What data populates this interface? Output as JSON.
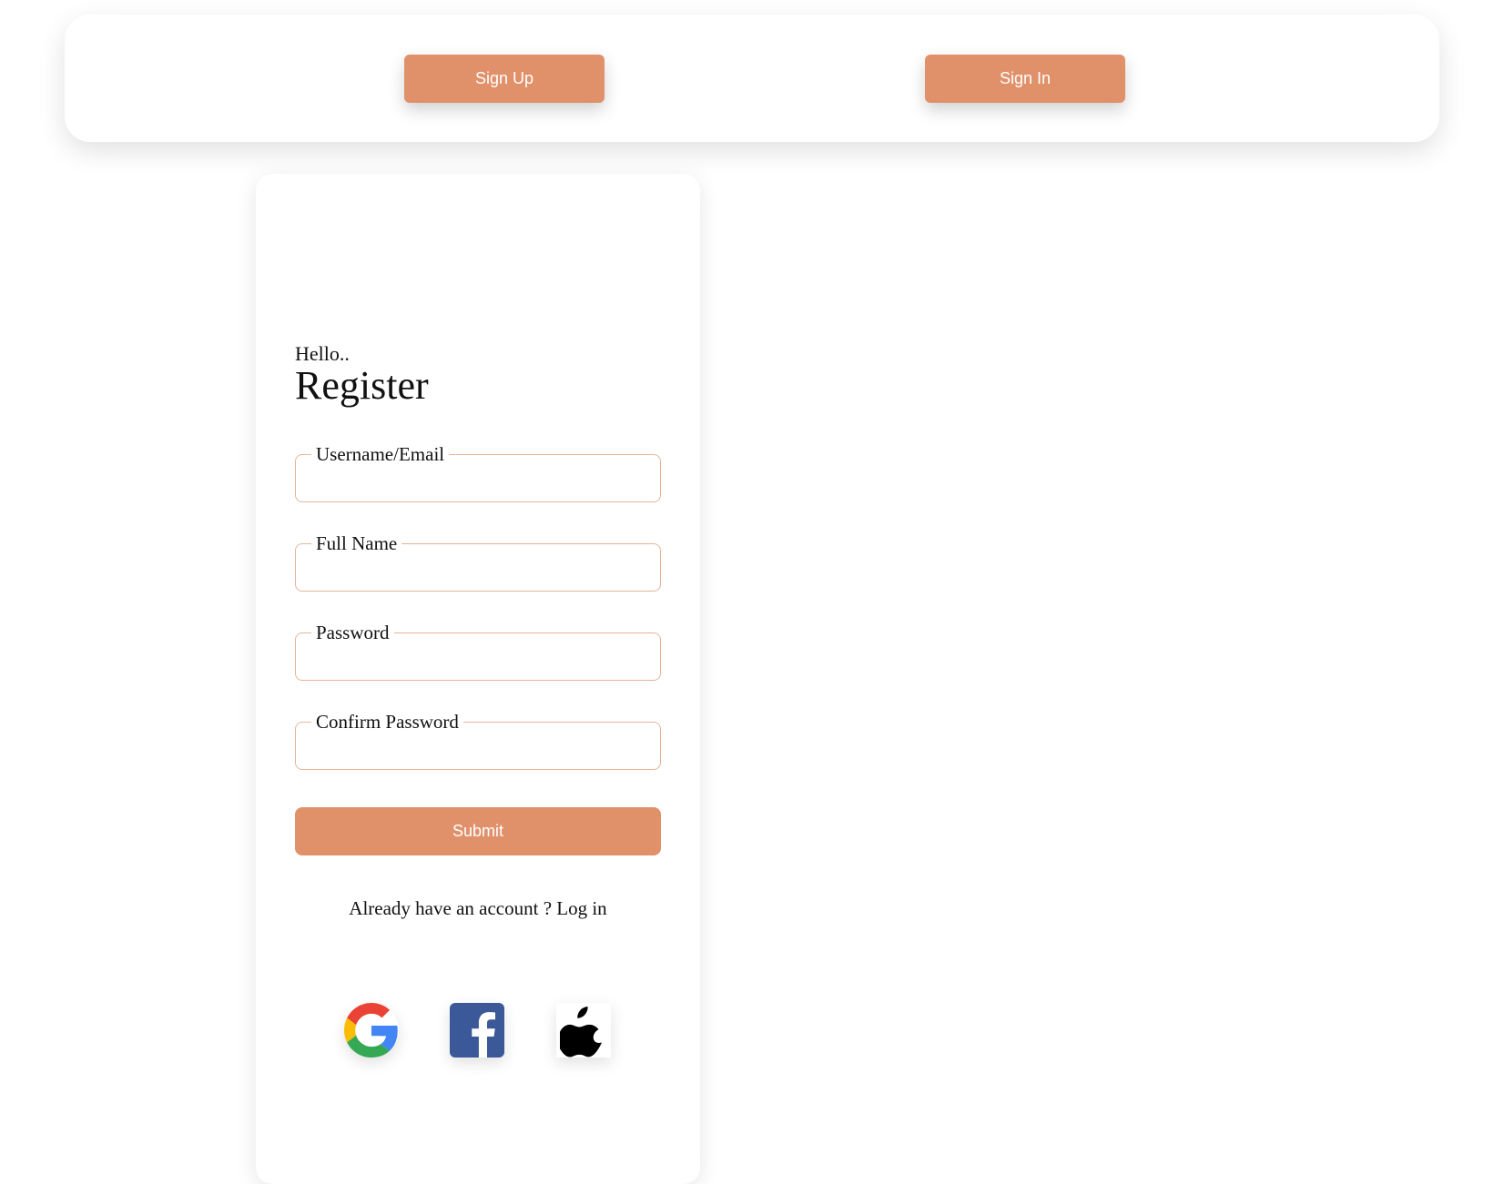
{
  "nav": {
    "signup_label": "Sign Up",
    "signin_label": "Sign In"
  },
  "form": {
    "greeting": "Hello..",
    "title": "Register",
    "fields": [
      {
        "label": "Username/Email",
        "value": ""
      },
      {
        "label": "Full Name",
        "value": ""
      },
      {
        "label": "Password",
        "value": ""
      },
      {
        "label": "Confirm Password",
        "value": ""
      }
    ],
    "submit_label": "Submit",
    "already_text": "Already have an account ?",
    "login_label": "Log in"
  },
  "social": [
    {
      "name": "google",
      "icon": "google-icon"
    },
    {
      "name": "facebook",
      "icon": "facebook-icon"
    },
    {
      "name": "apple",
      "icon": "apple-icon"
    }
  ],
  "colors": {
    "accent": "#e0916a",
    "field_border": "#e6b49a",
    "facebook_blue": "#3b5998"
  }
}
